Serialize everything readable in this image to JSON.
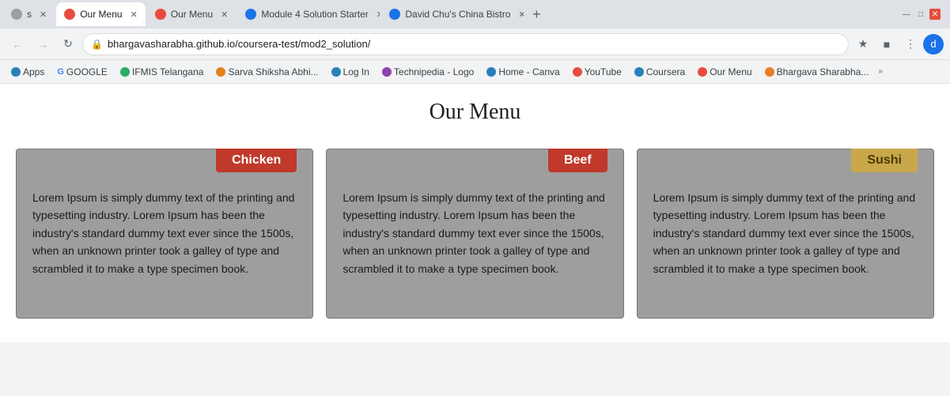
{
  "browser": {
    "tabs": [
      {
        "id": "tab1",
        "label": "s",
        "active": false,
        "favicon_color": "#5f6368"
      },
      {
        "id": "tab2",
        "label": "Our Menu",
        "active": true,
        "favicon_color": "#e74c3c"
      },
      {
        "id": "tab3",
        "label": "Our Menu",
        "active": false,
        "favicon_color": "#e74c3c"
      },
      {
        "id": "tab4",
        "label": "Module 4 Solution Starter",
        "active": false,
        "favicon_color": "#1a73e8"
      },
      {
        "id": "tab5",
        "label": "David Chu's China Bistro",
        "active": false,
        "favicon_color": "#1a73e8"
      }
    ],
    "address": "bhargavasharabha.github.io/coursera-test/mod2_solution/",
    "window_controls": {
      "minimize": "—",
      "maximize": "□",
      "close": "✕"
    }
  },
  "bookmarks": [
    {
      "id": "bm1",
      "label": "Apps",
      "type": "apps"
    },
    {
      "id": "bm2",
      "label": "GOOGLE",
      "type": "google"
    },
    {
      "id": "bm3",
      "label": "IFMIS Telangana",
      "type": "site"
    },
    {
      "id": "bm4",
      "label": "Sarva Shiksha Abhi...",
      "type": "site"
    },
    {
      "id": "bm5",
      "label": "Log In",
      "type": "site"
    },
    {
      "id": "bm6",
      "label": "Technipedia - Logo",
      "type": "site"
    },
    {
      "id": "bm7",
      "label": "Home - Canva",
      "type": "site"
    },
    {
      "id": "bm8",
      "label": "YouTube",
      "type": "youtube"
    },
    {
      "id": "bm9",
      "label": "Coursera",
      "type": "site"
    },
    {
      "id": "bm10",
      "label": "Our Menu",
      "type": "site"
    },
    {
      "id": "bm11",
      "label": "Bhargava Sharabha...",
      "type": "site"
    }
  ],
  "page": {
    "title": "Our Menu",
    "menu_cards": [
      {
        "id": "card1",
        "badge_label": "Chicken",
        "badge_type": "chicken",
        "text": "Lorem Ipsum is simply dummy text of the printing and typesetting industry. Lorem Ipsum has been the industry's standard dummy text ever since the 1500s, when an unknown printer took a galley of type and scrambled it to make a type specimen book."
      },
      {
        "id": "card2",
        "badge_label": "Beef",
        "badge_type": "beef",
        "text": "Lorem Ipsum is simply dummy text of the printing and typesetting industry. Lorem Ipsum has been the industry's standard dummy text ever since the 1500s, when an unknown printer took a galley of type and scrambled it to make a type specimen book."
      },
      {
        "id": "card3",
        "badge_label": "Sushi",
        "badge_type": "sushi",
        "text": "Lorem Ipsum is simply dummy text of the printing and typesetting industry. Lorem Ipsum has been the industry's standard dummy text ever since the 1500s, when an unknown printer took a galley of type and scrambled it to make a type specimen book."
      }
    ]
  }
}
